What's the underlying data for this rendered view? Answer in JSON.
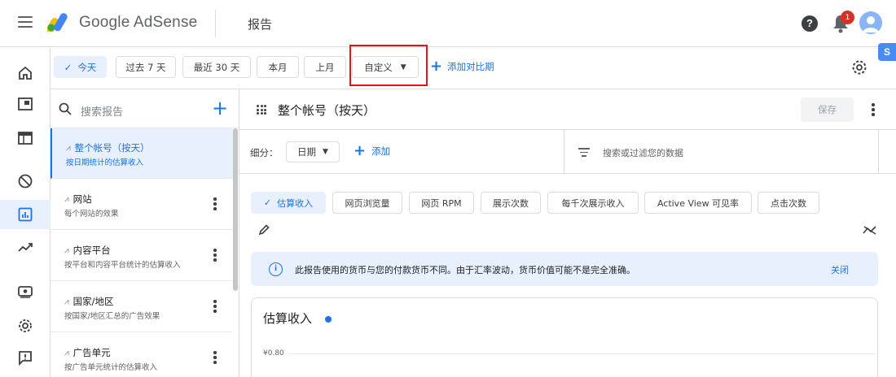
{
  "app": {
    "brand": "Google AdSense",
    "page_title": "报告",
    "help_label": "?",
    "notification_count": "1",
    "extension_label": "S"
  },
  "date_filters": {
    "chips": [
      "今天",
      "过去 7 天",
      "最近 30 天",
      "本月",
      "上月",
      "自定义"
    ],
    "selected": "今天",
    "add_compare": "添加对比期"
  },
  "reports": {
    "search_placeholder": "搜索报告",
    "items": [
      {
        "title": "整个帐号（按天）",
        "subtitle": "按日期统计的估算收入",
        "active": true
      },
      {
        "title": "网站",
        "subtitle": "每个网站的效果"
      },
      {
        "title": "内容平台",
        "subtitle": "按平台和内容平台统计的估算收入"
      },
      {
        "title": "国家/地区",
        "subtitle": "按国家/地区汇总的广告效果"
      },
      {
        "title": "广告单元",
        "subtitle": "按广告单元统计的估算收入"
      }
    ]
  },
  "main": {
    "title": "整个帐号（按天）",
    "save_label": "保存",
    "breakdown_label": "细分：",
    "breakdown_value": "日期",
    "add_breakdown": "添加",
    "filter_placeholder": "搜索或过滤您的数据",
    "metrics": [
      "估算收入",
      "网页浏览量",
      "网页 RPM",
      "展示次数",
      "每千次展示收入",
      "Active View 可见率",
      "点击次数"
    ],
    "selected_metric": "估算收入",
    "banner_text": "此报告使用的货币与您的付款货币不同。由于汇率波动，货币价值可能不是完全准确。",
    "banner_close": "关闭",
    "card_title": "估算收入",
    "y_tick": "¥0.80"
  },
  "colors": {
    "accent": "#1a73e8",
    "highlight_box": "#e0151c",
    "active_bg": "#e8f0fe"
  }
}
